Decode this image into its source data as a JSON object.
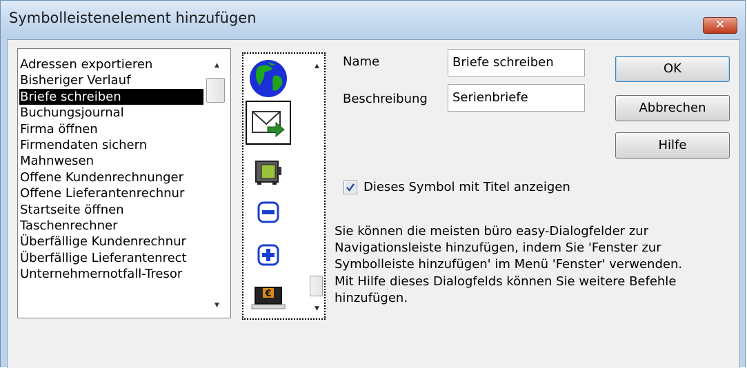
{
  "window": {
    "title": "Symbolleistenelement hinzufügen",
    "close_glyph": "✕"
  },
  "command_list": {
    "items": [
      "Adressen exportieren",
      "Bisheriger Verlauf",
      "Briefe schreiben",
      "Buchungsjournal",
      "Firma öffnen",
      "Firmendaten sichern",
      "Mahnwesen",
      "Offene Kundenrechnunger",
      "Offene Lieferantenrechnur",
      "Startseite öffnen",
      "Taschenrechner",
      "Überfällige Kundenrechnur",
      "Überfällige Lieferantenrect",
      "Unternehmernotfall-Tresor"
    ],
    "selected_index": 2
  },
  "icon_list": {
    "icons": [
      "globe-icon",
      "envelope-arrow-icon",
      "safe-icon",
      "minus-icon",
      "plus-icon",
      "euro-monitor-icon"
    ],
    "selected_index": 1
  },
  "form": {
    "name_label": "Name",
    "name_value": "Briefe schreiben",
    "description_label": "Beschreibung",
    "description_value": "Serienbriefe"
  },
  "buttons": {
    "ok": "OK",
    "cancel": "Abbrechen",
    "help": "Hilfe"
  },
  "checkbox": {
    "label": "Dieses Symbol mit Titel anzeigen",
    "checked": true
  },
  "info_text": {
    "lines": [
      "Sie können die meisten büro easy-Dialogfelder zur",
      "Navigationsleiste hinzufügen, indem Sie 'Fenster zur",
      "Symbolleiste hinzufügen' im Menü 'Fenster' verwenden.",
      "Mit Hilfe dieses Dialogfelds können Sie weitere Befehle",
      "hinzufügen."
    ]
  },
  "colors": {
    "selection_bg": "#000000",
    "title_bar": "#c9dcf0",
    "close_button": "#c9452a"
  }
}
